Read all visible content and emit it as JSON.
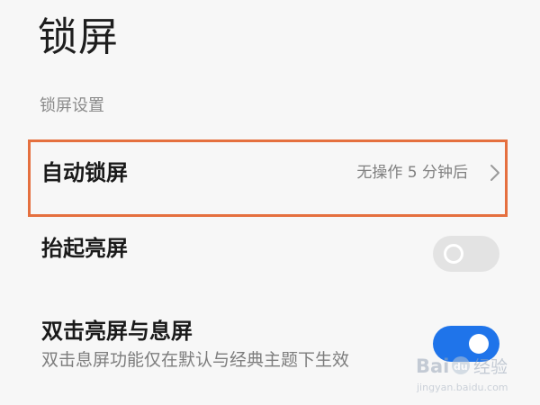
{
  "page": {
    "title": "锁屏"
  },
  "section": {
    "header": "锁屏设置"
  },
  "rows": {
    "auto_lock": {
      "title": "自动锁屏",
      "value": "无操作 5 分钟后",
      "icon": "chevron-right-icon"
    },
    "raise_to_wake": {
      "title": "抬起亮屏",
      "toggle_on": false
    },
    "double_tap": {
      "title": "双击亮屏与息屏",
      "subtitle": "双击息屏功能仅在默认与经典主题下生效",
      "toggle_on": true
    }
  },
  "watermark": {
    "brand": "Bai",
    "paw": "du",
    "suffix": "经验",
    "url": "jingyan.baidu.com"
  },
  "colors": {
    "background": "#f7f7f7",
    "highlight_border": "#e5703f",
    "toggle_on": "#1f74ea",
    "toggle_off": "#e3e3e3",
    "secondary_text": "#7f7f7f"
  }
}
